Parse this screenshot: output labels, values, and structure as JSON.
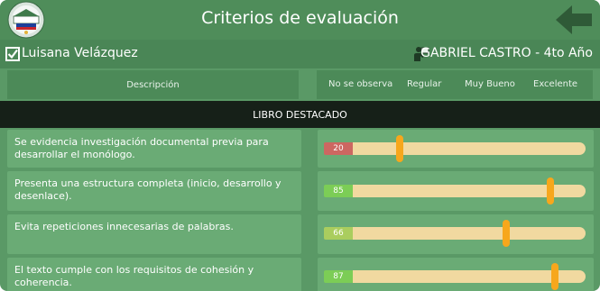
{
  "header": {
    "title": "Criterios de evaluación"
  },
  "info": {
    "student_name": "Luisana Velázquez",
    "teacher_course": "GABRIEL CASTRO - 4to Año"
  },
  "table_header": {
    "description": "Descripción",
    "levels": [
      "No se observa",
      "Regular",
      "Muy Bueno",
      "Excelente"
    ]
  },
  "section": {
    "title": "LIBRO DESTACADO"
  },
  "criteria": [
    {
      "text": "Se evidencia investigación documental previa para desarrollar el monólogo.",
      "score": "20",
      "value": 20,
      "badge_color": "#cd6761"
    },
    {
      "text": "Presenta una estructura completa (inicio, desarrollo y desenlace).",
      "score": "85",
      "value": 85,
      "badge_color": "#7ccd56"
    },
    {
      "text": "Evita repeticiones innecesarias de palabras.",
      "score": "66",
      "value": 66,
      "badge_color": "#aacd5e"
    },
    {
      "text": "El texto cumple con los requisitos de cohesión y coherencia.",
      "score": "87",
      "value": 87,
      "badge_color": "#7ccd56"
    }
  ],
  "icons": {
    "logo": "school-logo-icon",
    "back": "back-arrow-icon",
    "student": "checkbox-icon",
    "teacher": "teacher-icon"
  },
  "colors": {
    "header": "#4f8d5a",
    "background": "#5a9966",
    "section_bar": "#162018",
    "track": "#f1d9a0",
    "thumb": "#f7a71c"
  }
}
